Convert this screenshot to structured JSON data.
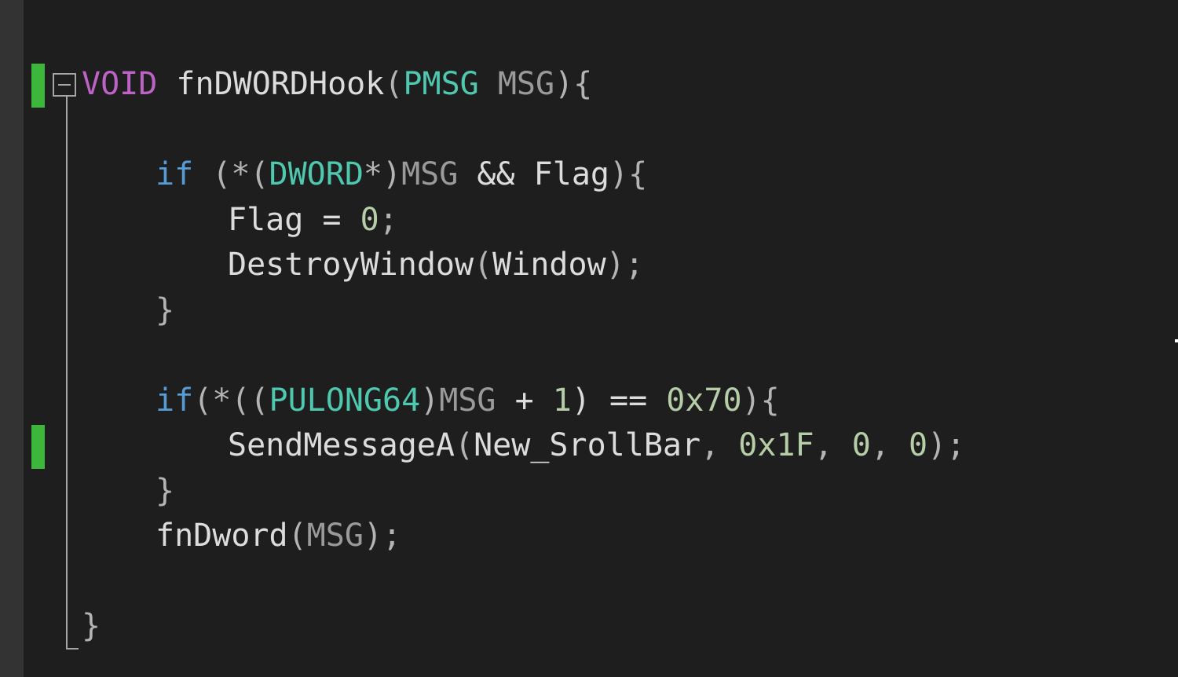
{
  "editor": {
    "lines": [
      {
        "indent": 0,
        "tokens": [
          {
            "t": "VOID",
            "c": "macro"
          },
          {
            "t": " ",
            "c": "plain"
          },
          {
            "t": "fnDWORDHook",
            "c": "plain"
          },
          {
            "t": "(",
            "c": "punct"
          },
          {
            "t": "PMSG",
            "c": "type"
          },
          {
            "t": " ",
            "c": "plain"
          },
          {
            "t": "MSG",
            "c": "param"
          },
          {
            "t": "){",
            "c": "punct"
          }
        ]
      },
      {
        "indent": 0,
        "tokens": []
      },
      {
        "indent": 1,
        "tokens": [
          {
            "t": "if",
            "c": "kw"
          },
          {
            "t": " (*(",
            "c": "punct"
          },
          {
            "t": "DWORD",
            "c": "type"
          },
          {
            "t": "*)",
            "c": "punct"
          },
          {
            "t": "MSG",
            "c": "param"
          },
          {
            "t": " && ",
            "c": "plain"
          },
          {
            "t": "Flag",
            "c": "plain"
          },
          {
            "t": "){",
            "c": "punct"
          }
        ]
      },
      {
        "indent": 2,
        "tokens": [
          {
            "t": "Flag",
            "c": "plain"
          },
          {
            "t": " = ",
            "c": "plain"
          },
          {
            "t": "0",
            "c": "num"
          },
          {
            "t": ";",
            "c": "punct"
          }
        ]
      },
      {
        "indent": 2,
        "tokens": [
          {
            "t": "DestroyWindow",
            "c": "plain"
          },
          {
            "t": "(",
            "c": "punct"
          },
          {
            "t": "Window",
            "c": "plain"
          },
          {
            "t": ");",
            "c": "punct"
          }
        ]
      },
      {
        "indent": 1,
        "tokens": [
          {
            "t": "}",
            "c": "punct"
          }
        ]
      },
      {
        "indent": 0,
        "tokens": []
      },
      {
        "indent": 1,
        "tokens": [
          {
            "t": "if",
            "c": "kw"
          },
          {
            "t": "(*((",
            "c": "punct"
          },
          {
            "t": "PULONG64",
            "c": "type"
          },
          {
            "t": ")",
            "c": "punct"
          },
          {
            "t": "MSG",
            "c": "param"
          },
          {
            "t": " + ",
            "c": "plain"
          },
          {
            "t": "1",
            "c": "num"
          },
          {
            "t": ") == ",
            "c": "plain"
          },
          {
            "t": "0x70",
            "c": "num"
          },
          {
            "t": "){",
            "c": "punct"
          }
        ]
      },
      {
        "indent": 2,
        "tokens": [
          {
            "t": "SendMessageA",
            "c": "plain"
          },
          {
            "t": "(",
            "c": "punct"
          },
          {
            "t": "New_SrollBar",
            "c": "plain"
          },
          {
            "t": ", ",
            "c": "punct"
          },
          {
            "t": "0x1F",
            "c": "num"
          },
          {
            "t": ", ",
            "c": "punct"
          },
          {
            "t": "0",
            "c": "num"
          },
          {
            "t": ", ",
            "c": "punct"
          },
          {
            "t": "0",
            "c": "num"
          },
          {
            "t": ");",
            "c": "punct"
          }
        ]
      },
      {
        "indent": 1,
        "tokens": [
          {
            "t": "}",
            "c": "punct"
          }
        ]
      },
      {
        "indent": 1,
        "tokens": [
          {
            "t": "fnDword",
            "c": "plain"
          },
          {
            "t": "(",
            "c": "punct"
          },
          {
            "t": "MSG",
            "c": "param"
          },
          {
            "t": ");",
            "c": "punct"
          }
        ]
      },
      {
        "indent": 0,
        "tokens": []
      },
      {
        "indent": 0,
        "tokens": [
          {
            "t": "}",
            "c": "punct"
          }
        ]
      }
    ],
    "changed_lines": [
      0,
      8
    ],
    "colors": {
      "background": "#1e1e1e",
      "keyword": "#569cd6",
      "macro": "#bd63c5",
      "type": "#4ec9b0",
      "parameter": "#9a9a9a",
      "number": "#b5cea8",
      "text": "#dcdcdc",
      "change_marker": "#3cb73c"
    }
  }
}
